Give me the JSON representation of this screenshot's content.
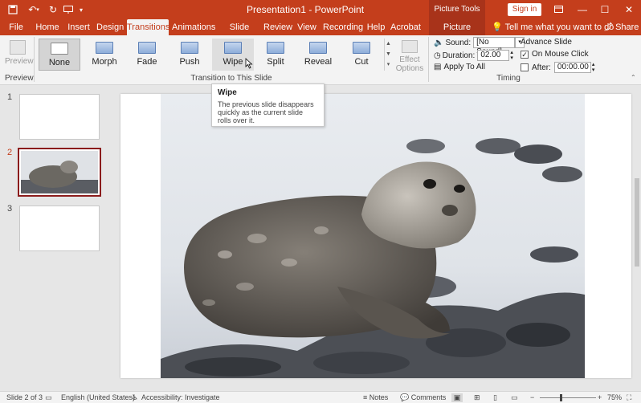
{
  "window": {
    "title": "Presentation1 - PowerPoint",
    "contextual_tab_header": "Picture Tools",
    "sign_in": "Sign in"
  },
  "tabs": [
    {
      "label": "File"
    },
    {
      "label": "Home"
    },
    {
      "label": "Insert"
    },
    {
      "label": "Design"
    },
    {
      "label": "Transitions"
    },
    {
      "label": "Animations"
    },
    {
      "label": "Slide Show"
    },
    {
      "label": "Review"
    },
    {
      "label": "View"
    },
    {
      "label": "Recording"
    },
    {
      "label": "Help"
    },
    {
      "label": "Acrobat"
    },
    {
      "label": "Picture Format"
    }
  ],
  "active_tab": "Transitions",
  "tell_me": "Tell me what you want to do",
  "share": "Share",
  "ribbon": {
    "preview": {
      "button": "Preview",
      "group": "Preview"
    },
    "transitions": {
      "group": "Transition to This Slide",
      "items": [
        {
          "label": "None"
        },
        {
          "label": "Morph"
        },
        {
          "label": "Fade"
        },
        {
          "label": "Push"
        },
        {
          "label": "Wipe"
        },
        {
          "label": "Split"
        },
        {
          "label": "Reveal"
        },
        {
          "label": "Cut"
        }
      ],
      "selected": "None",
      "hovered": "Wipe"
    },
    "effect_options": {
      "line1": "Effect",
      "line2": "Options"
    },
    "timing": {
      "group": "Timing",
      "sound_label": "Sound:",
      "sound_value": "[No Sound]",
      "duration_label": "Duration:",
      "duration_value": "02.00",
      "apply_all": "Apply To All",
      "advance_title": "Advance Slide",
      "on_mouse_click": "On Mouse Click",
      "after_label": "After:",
      "after_value": "00:00.00"
    }
  },
  "tooltip": {
    "title": "Wipe",
    "body": "The previous slide disappears quickly as the current slide rolls over it."
  },
  "slides": [
    {
      "number": "1"
    },
    {
      "number": "2"
    },
    {
      "number": "3"
    }
  ],
  "status": {
    "slide_of": "Slide 2 of 3",
    "language": "English (United States)",
    "accessibility": "Accessibility: Investigate",
    "notes": "Notes",
    "comments": "Comments",
    "zoom": "75%"
  },
  "colors": {
    "accent": "#c43e1c",
    "selected_slide_border": "#8b1c1c"
  }
}
